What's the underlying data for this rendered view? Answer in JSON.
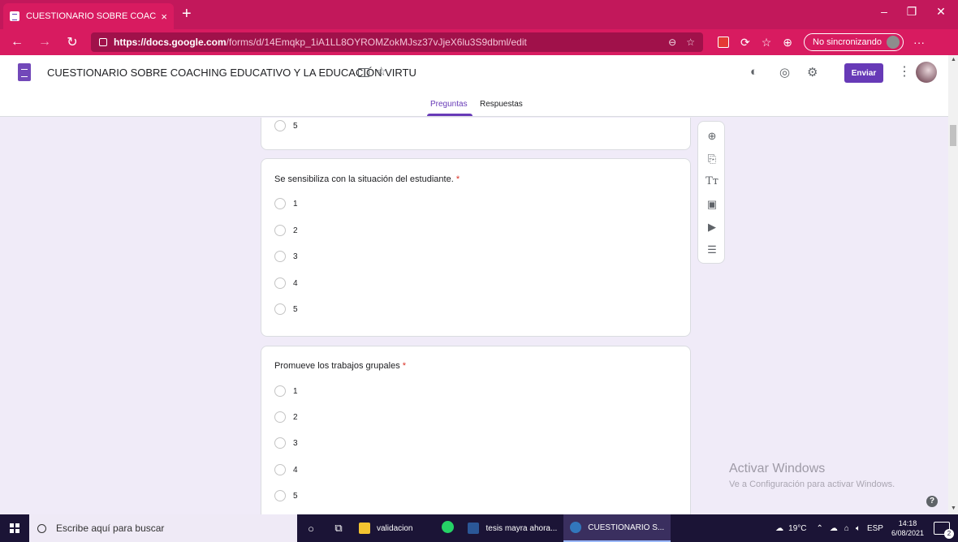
{
  "browser": {
    "tab_title": "CUESTIONARIO SOBRE COACHIN",
    "tab_close": "×",
    "new_tab": "+",
    "url_host": "https://docs.google.com",
    "url_path": "/forms/d/14Emqkp_1iA1LL8OYROMZokMJsz37vJjeX6lu3S9dbml/edit",
    "sync_label": "No sincronizando",
    "accent_color": "#d81b60"
  },
  "form_header": {
    "title": "CUESTIONARIO SOBRE COACHING EDUCATIVO Y LA EDUCACIÓN VIRTU",
    "send_label": "Enviar",
    "tabs": [
      {
        "label": "Preguntas",
        "active": true
      },
      {
        "label": "Respuestas",
        "active": false
      }
    ],
    "brand_color": "#673ab7"
  },
  "questions": [
    {
      "title": "",
      "required": false,
      "options": [
        "5"
      ]
    },
    {
      "title": "Se sensibiliza con la situación del estudiante.",
      "required": true,
      "options": [
        "1",
        "2",
        "3",
        "4",
        "5"
      ]
    },
    {
      "title": "Promueve los trabajos grupales",
      "required": true,
      "options": [
        "1",
        "2",
        "3",
        "4",
        "5"
      ]
    }
  ],
  "required_mark": "*",
  "side_tools": [
    "add-question-icon",
    "import-questions-icon",
    "add-title-icon",
    "add-image-icon",
    "add-video-icon",
    "add-section-icon"
  ],
  "watermark": {
    "line1": "Activar Windows",
    "line2": "Ve a Configuración para activar Windows."
  },
  "taskbar": {
    "search_placeholder": "Escribe aquí para buscar",
    "apps": [
      {
        "label": "validacion",
        "color": "#f4c430"
      },
      {
        "label": "tesis mayra ahora...",
        "color": "#2b5797"
      },
      {
        "label": "CUESTIONARIO S...",
        "color": "#3277bc"
      }
    ],
    "weather": "19°C",
    "language": "ESP",
    "time": "14:18",
    "date": "6/08/2021",
    "notifications": "2"
  }
}
